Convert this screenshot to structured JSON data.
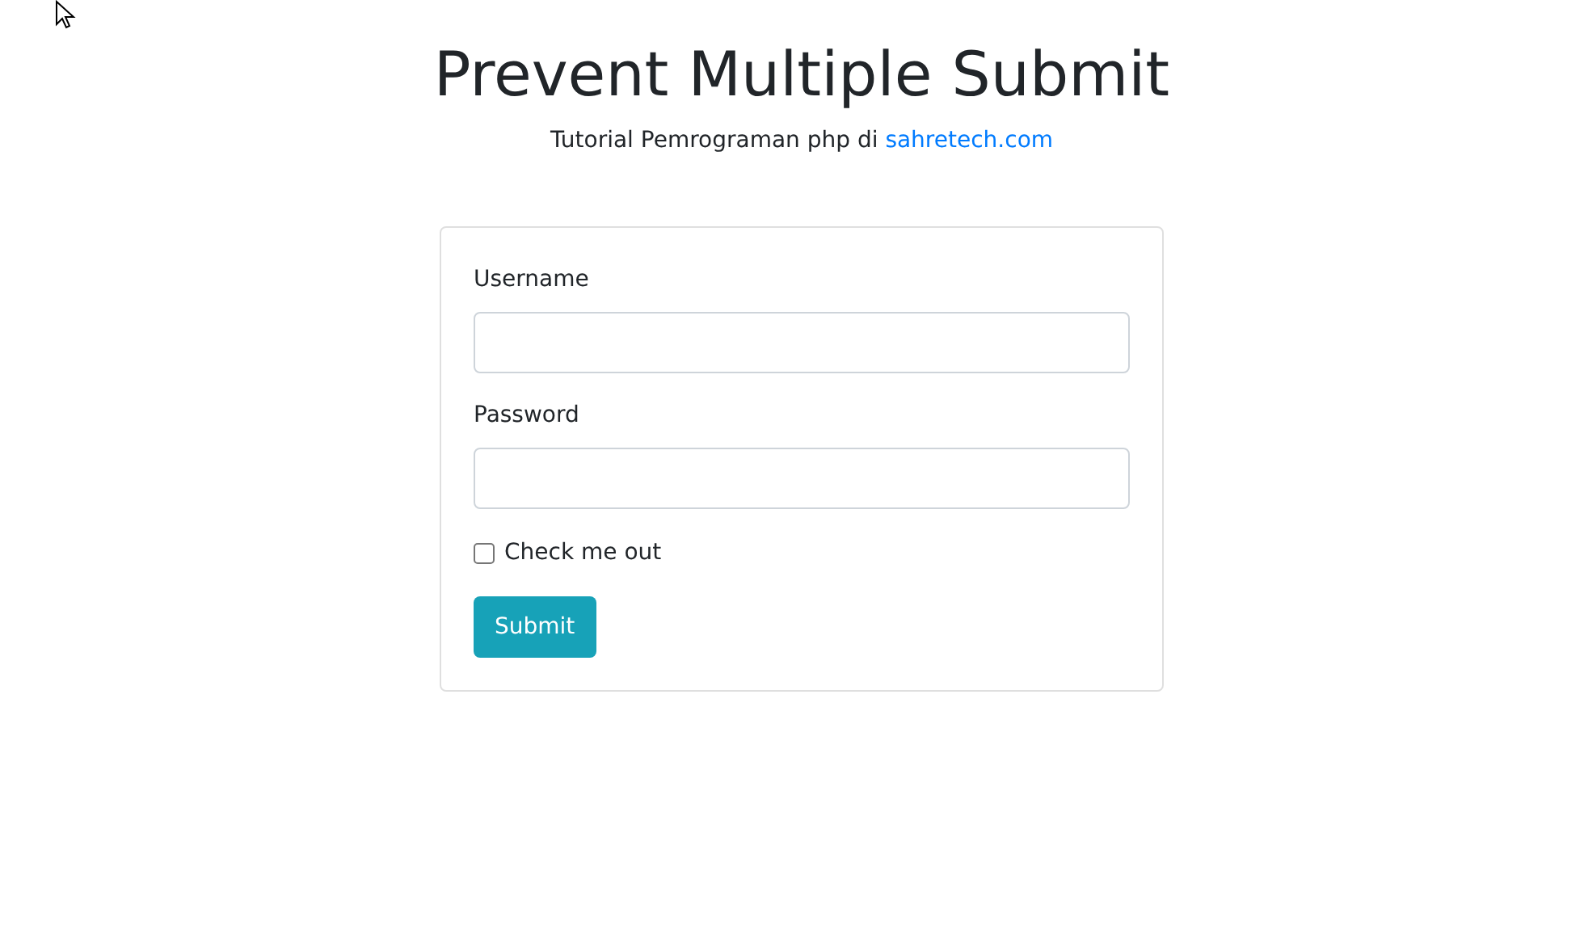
{
  "title": "Prevent Multiple Submit",
  "subtitle": {
    "text": "Tutorial Pemrograman php di",
    "link": "sahretech.com"
  },
  "form": {
    "fields": [
      {
        "label": "Username"
      },
      {
        "label": "Password"
      }
    ],
    "checkbox": {
      "label": "Check me out",
      "checked": false
    },
    "submit_button": "Submit"
  }
}
